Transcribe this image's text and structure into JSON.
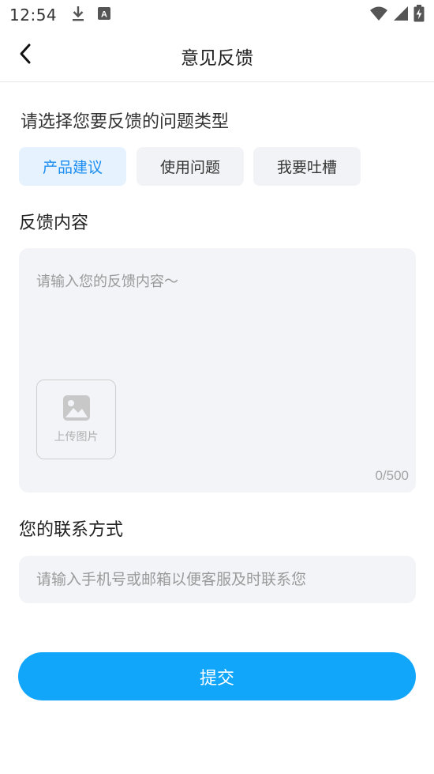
{
  "status_bar": {
    "time": "12:54",
    "icons": [
      "download-icon",
      "a-notification-icon",
      "wifi-icon",
      "signal-icon",
      "battery-charging-icon"
    ]
  },
  "nav": {
    "title": "意见反馈",
    "back_icon": "chevron-left-icon"
  },
  "feedback_type": {
    "label": "请选择您要反馈的问题类型",
    "options": [
      {
        "label": "产品建议",
        "selected": true
      },
      {
        "label": "使用问题",
        "selected": false
      },
      {
        "label": "我要吐槽",
        "selected": false
      }
    ]
  },
  "feedback_content": {
    "label": "反馈内容",
    "placeholder": "请输入您的反馈内容～",
    "upload_label": "上传图片",
    "upload_icon": "image-icon",
    "counter": "0/500"
  },
  "contact": {
    "label": "您的联系方式",
    "placeholder": "请输入手机号或邮箱以便客服及时联系您"
  },
  "submit": {
    "label": "提交"
  },
  "colors": {
    "accent": "#12a6fa",
    "chip_selected_bg": "#e6f3ff",
    "chip_selected_text": "#1a8cf0",
    "input_bg": "#f3f4f8"
  }
}
